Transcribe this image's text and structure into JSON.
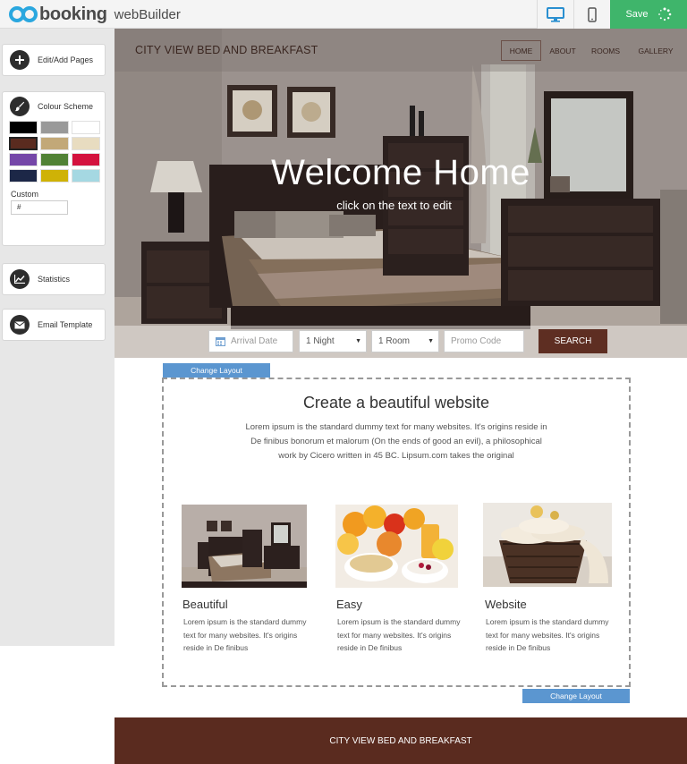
{
  "app": {
    "logo_text": "booking",
    "logo_suffix": "webBuilder",
    "save_label": "Save"
  },
  "sidebar": {
    "edit_pages_label": "Edit/Add Pages",
    "colour_scheme_label": "Colour Scheme",
    "swatch_colors": [
      "#000000",
      "#999999",
      "#ffffff",
      "#5a2b1f",
      "#c2a878",
      "#e8dcc0",
      "#7547a8",
      "#518235",
      "#d4123e",
      "#1c2747",
      "#cfb206",
      "#a5d8e2"
    ],
    "selected_swatch": "#5a2b1f",
    "custom_label": "Custom",
    "custom_value": "#",
    "statistics_label": "Statistics",
    "email_template_label": "Email Template"
  },
  "site": {
    "title": "CITY VIEW BED AND BREAKFAST",
    "nav": [
      "HOME",
      "ABOUT",
      "ROOMS",
      "GALLERY"
    ],
    "active_nav": "HOME",
    "hero_heading": "Welcome Home",
    "hero_sub": "click on the text to edit"
  },
  "booking": {
    "arrival_placeholder": "Arrival Date",
    "nights_value": "1 Night",
    "rooms_value": "1 Room",
    "promo_placeholder": "Promo Code",
    "search_label": "SEARCH"
  },
  "content": {
    "change_layout_label": "Change Layout",
    "heading": "Create a beautiful website",
    "lead": "Lorem ipsum is the standard dummy text for many websites. It's origins reside in De finibus bonorum et malorum (On the ends of good an evil), a philosophical work by Cicero written in 45 BC. Lipsum.com takes the original",
    "cards": [
      {
        "title": "Beautiful",
        "text": "Lorem ipsum is the standard dummy text for many websites. It's origins reside in De finibus"
      },
      {
        "title": "Easy",
        "text": "Lorem ipsum is the standard dummy text for many websites. It's origins reside in De finibus"
      },
      {
        "title": "Website",
        "text": "Lorem ipsum is the standard dummy text for many websites. It's origins reside in De finibus"
      }
    ]
  },
  "footer": {
    "text": "CITY VIEW BED AND BREAKFAST"
  }
}
